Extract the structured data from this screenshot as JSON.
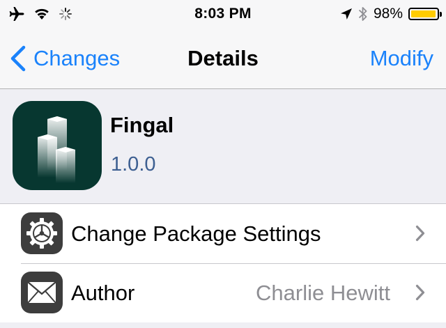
{
  "status_bar": {
    "time": "8:03 PM",
    "battery_percent": "98%",
    "battery_level": 0.98,
    "battery_color": "#ffcc00",
    "icons": [
      "airplane-icon",
      "wifi-icon",
      "activity-spinner-icon",
      "location-arrow-icon",
      "bluetooth-icon",
      "battery-icon"
    ]
  },
  "nav": {
    "back_label": "Changes",
    "title": "Details",
    "right_label": "Modify",
    "accent_color": "#1a82fb"
  },
  "package": {
    "name": "Fingal",
    "version": "1.0.0",
    "icon": "fingal-app-icon"
  },
  "rows": [
    {
      "label": "Change Package Settings",
      "value": "",
      "icon": "gear-icon"
    },
    {
      "label": "Author",
      "value": "Charlie Hewitt",
      "icon": "envelope-icon"
    }
  ]
}
